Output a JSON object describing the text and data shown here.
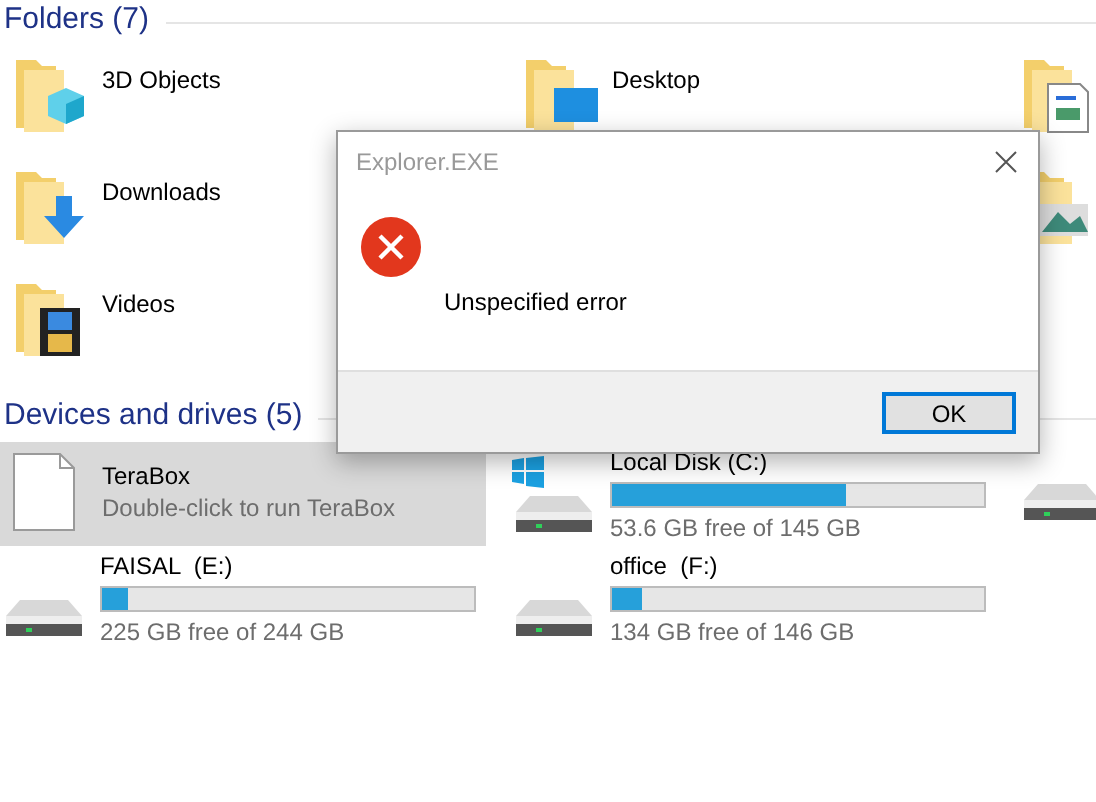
{
  "folders_header": "Folders (7)",
  "folders": [
    {
      "name": "3D Objects"
    },
    {
      "name": "Desktop"
    },
    {
      "name": "Downloads"
    },
    {
      "name": "Videos"
    }
  ],
  "drives_header": "Devices and drives (5)",
  "drives": [
    {
      "kind": "app",
      "name": "TeraBox",
      "subtitle": "Double-click to run TeraBox",
      "selected": true
    },
    {
      "kind": "disk",
      "name": "Local Disk (C:)",
      "level": 0.63,
      "reading": "53.6 GB free of 145 GB",
      "selected": false
    },
    {
      "kind": "disk",
      "name": "FAISAL  (E:)",
      "level": 0.07,
      "reading": "225 GB free of 244 GB",
      "selected": false
    },
    {
      "kind": "disk",
      "name": "office  (F:)",
      "level": 0.08,
      "reading": "134 GB free of 146 GB",
      "selected": false
    }
  ],
  "dialog": {
    "title": "Explorer.EXE",
    "message": "Unspecified error",
    "buttons": [
      "OK"
    ]
  }
}
